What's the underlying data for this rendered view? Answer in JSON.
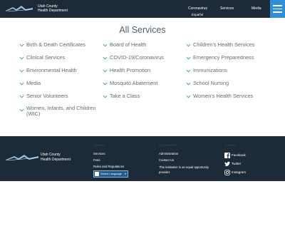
{
  "header": {
    "logo_line1": "Utah County",
    "logo_line2": "Health Department",
    "nav": [
      "Coronavirus",
      "Services",
      "Media"
    ],
    "espanol": "Español",
    "menu_icon": "hamburger-icon"
  },
  "main": {
    "title": "All Services",
    "columns": [
      [
        "Birth & Death Certificates",
        "Clinical Services",
        "Environmental Health",
        "Media",
        "Senior Volunteers",
        "Women, Infants, and Children (WIC)"
      ],
      [
        "Board of Health",
        "COVID-19/Coronavirus",
        "Health Promotion",
        "Mosquito Abatement",
        "Take a Class"
      ],
      [
        "Children's Health Services",
        "Emergency Preparedness",
        "Immunizations",
        "School Nursing",
        "Women's Health Services"
      ]
    ],
    "chevron_icon": "chevron-down-icon"
  },
  "footer": {
    "logo_line1": "Utah County",
    "logo_line2": "Health Department",
    "services_heading": "Services",
    "services_links": [
      "Services",
      "Fees",
      "Rules and Regulations"
    ],
    "language_label": "Select Language",
    "org_heading": "Organization",
    "org_links": [
      "Administration",
      "Contact Us"
    ],
    "equal_opportunity": "This institution is an equal opportunity provider.",
    "connect_heading": "Connect",
    "social": [
      {
        "label": "Facebook",
        "icon": "facebook-icon"
      },
      {
        "label": "Twitter",
        "icon": "twitter-icon"
      },
      {
        "label": "Instagram",
        "icon": "instagram-icon"
      }
    ]
  },
  "colors": {
    "header_bg": "#1d2a37",
    "accent": "#2f8fd8",
    "chevron": "#3aa36b"
  }
}
